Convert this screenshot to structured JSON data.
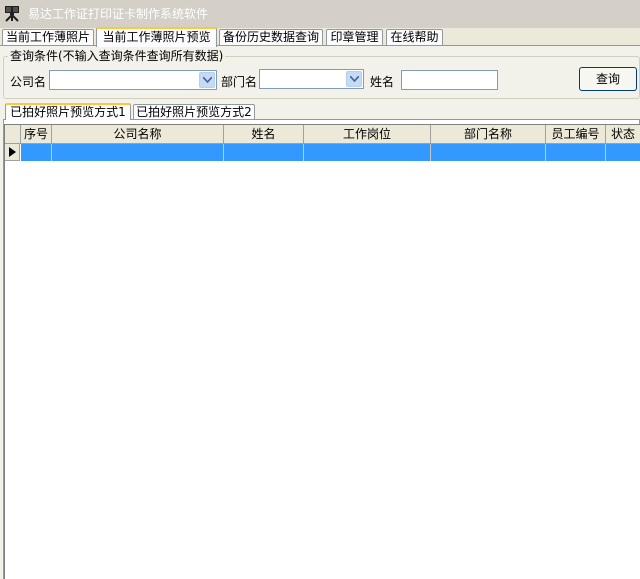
{
  "window": {
    "title": "易达工作证打印证卡制作系统软件",
    "icon": "camera-tripod-icon"
  },
  "main_tabs": [
    {
      "label": "当前工作薄照片",
      "active": false
    },
    {
      "label": "当前工作薄照片预览",
      "active": true
    },
    {
      "label": "备份历史数据查询",
      "active": false
    },
    {
      "label": "印章管理",
      "active": false
    },
    {
      "label": "在线帮助",
      "active": false
    }
  ],
  "query": {
    "group_title": "查询条件(不输入查询条件查询所有数据)",
    "company_label": "公司名",
    "company_value": "",
    "department_label": "部门名",
    "department_value": "",
    "name_label": "姓名",
    "name_value": "",
    "search_button": "查询"
  },
  "sub_tabs": [
    {
      "label": "已拍好照片预览方式1",
      "active": true
    },
    {
      "label": "已拍好照片预览方式2",
      "active": false
    }
  ],
  "grid": {
    "columns": [
      "序号",
      "公司名称",
      "姓名",
      "工作岗位",
      "部门名称",
      "员工编号",
      "状态"
    ],
    "rows": [
      {
        "selected": true,
        "cells": [
          "",
          "",
          "",
          "",
          "",
          "",
          ""
        ]
      }
    ]
  },
  "colors": {
    "selection": "#3399ff",
    "active_tab_accent": "#ffc83c",
    "window_bg": "#ece9d8"
  }
}
